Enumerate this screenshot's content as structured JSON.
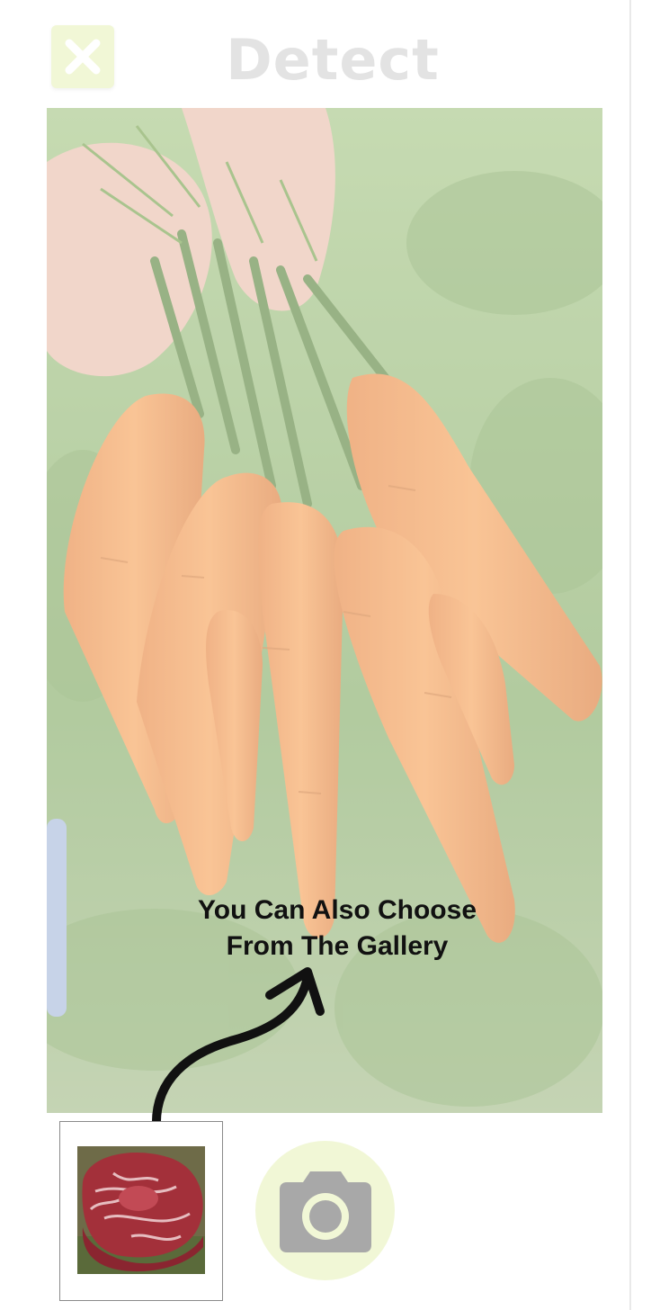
{
  "header": {
    "title": "Detect",
    "close_icon": "close-icon"
  },
  "preview": {
    "image": "carrots-bunch-photo",
    "hint_line1": "You Can Also Choose",
    "hint_line2": "From The Gallery",
    "arrow_icon": "curved-arrow-up-icon"
  },
  "bottom_bar": {
    "gallery_thumbnail": "steak-photo",
    "camera_icon": "camera-icon"
  },
  "colors": {
    "accent_light": "#f1f7d6",
    "title_text": "#e3e3e3",
    "hint_text": "#111111",
    "icon_grey": "#a8a8a8"
  }
}
